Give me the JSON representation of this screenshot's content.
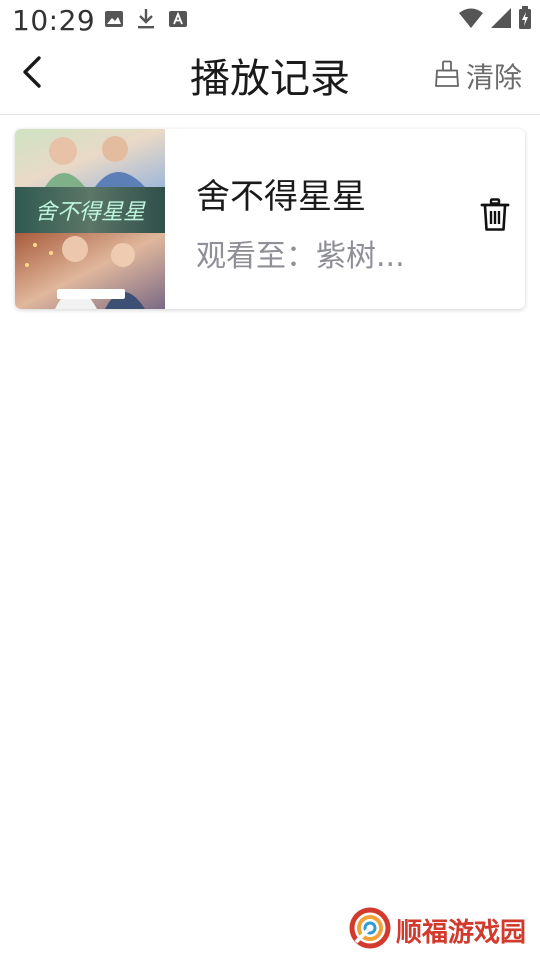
{
  "status_bar": {
    "time": "10:29",
    "left_icons": [
      "image-icon",
      "download-icon",
      "text-box-icon"
    ],
    "right_icons": [
      "wifi-icon",
      "signal-icon",
      "battery-icon"
    ]
  },
  "header": {
    "title": "播放记录",
    "back_icon": "chevron-left-icon",
    "clear_icon": "broom-icon",
    "clear_label": "清除"
  },
  "history": [
    {
      "title": "舍不得星星",
      "progress": "观看至：紫树...",
      "poster_title": "舍不得星星",
      "delete_icon": "trash-icon"
    }
  ],
  "watermark": {
    "text": "顺福游戏园",
    "logo_icon": "ring-logo-icon"
  },
  "colors": {
    "title": "#1a1a1a",
    "subtitle": "#8f8f97",
    "watermark": "#d23a2e",
    "divider": "#e6e6e6"
  }
}
